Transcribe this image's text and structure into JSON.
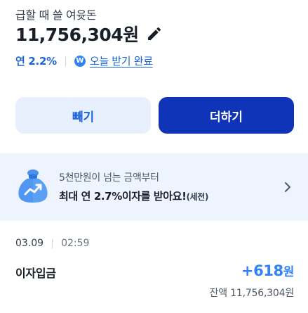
{
  "account": {
    "subtitle": "급할 때 쓸 여윳돈",
    "balance": "11,756,304원"
  },
  "interest": {
    "rate_label": "연 2.2%",
    "coin_symbol": "W",
    "paid_link": "오늘 받기 완료"
  },
  "actions": {
    "withdraw_label": "빼기",
    "deposit_label": "더하기"
  },
  "promo": {
    "line1": "5천만원이 넘는 금액부터",
    "line2_main": "최대 연 2.7%이자를 받아요!",
    "line2_suffix": "(세전)"
  },
  "transaction": {
    "date": "03.09",
    "time": "02:59",
    "title": "이자입금",
    "amount": "+618",
    "amount_unit": "원",
    "balance_after": "잔액 11,756,304원"
  },
  "colors": {
    "accent": "#3182f6",
    "primary_button": "#1034b8",
    "secondary_button": "#e8f0fd",
    "promo_bg": "#eef4fd"
  }
}
